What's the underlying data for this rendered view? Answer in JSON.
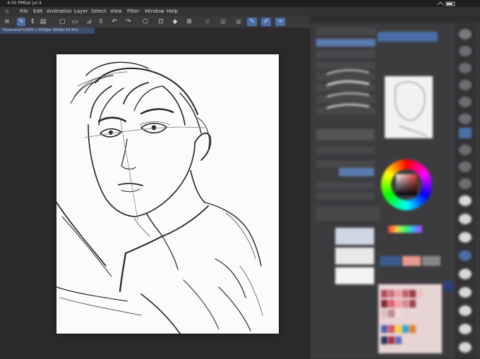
{
  "status_bar": {
    "time": "4:00 PM",
    "date": "Sat Jul 4"
  },
  "menu": {
    "items": [
      "File",
      "Edit",
      "Animation",
      "Layer",
      "Select",
      "View",
      "Filter",
      "Window",
      "Help"
    ]
  },
  "document_tab": {
    "label": "Illustration*(2000 x 2500px 300dpi 62.8%)"
  },
  "colors": {
    "accent": "#4a6fa8",
    "canvas_background": "#2a2a2c",
    "panel_background": "#3c3c3f",
    "paper": "#fbfbfb"
  },
  "toolbar": {
    "icons": [
      "menu-icon",
      "pen-icon",
      "adjust-icon",
      "layers-icon",
      "new-file-icon",
      "open-file-icon",
      "save-icon",
      "export-icon",
      "undo-icon",
      "redo-icon",
      "selection-icon",
      "transform-icon",
      "fill-icon",
      "crop-icon"
    ]
  }
}
